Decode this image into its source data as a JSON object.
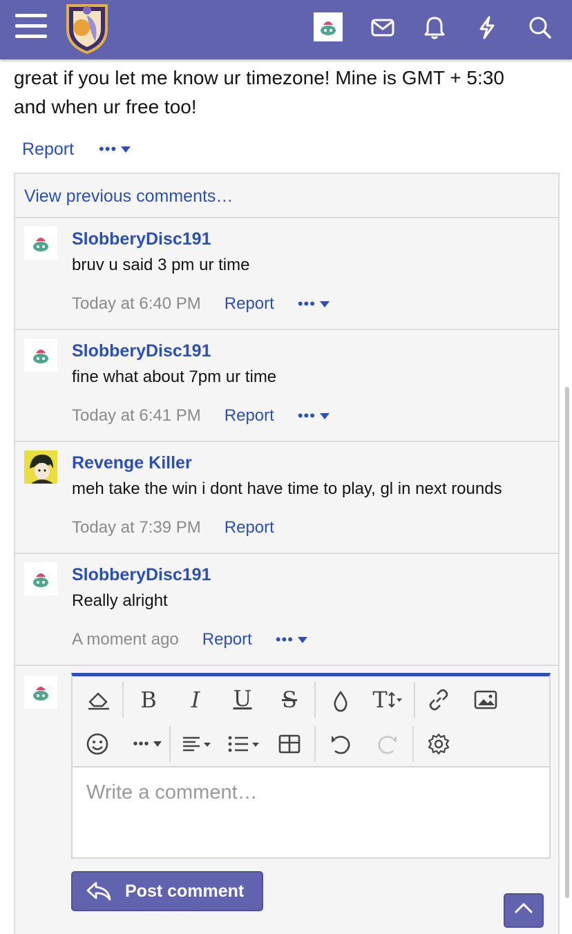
{
  "nav": {
    "icons": [
      "menu-icon",
      "site-logo",
      "user-avatar",
      "inbox-icon",
      "bell-icon",
      "bolt-icon",
      "search-icon"
    ],
    "accent": "#6163ae"
  },
  "post": {
    "text_line1": "great if you let me know ur timezone! Mine is GMT + 5:30",
    "text_line2": "and when ur free too!",
    "report_label": "Report",
    "more_label": "•••"
  },
  "comments": {
    "view_previous": "View previous comments…",
    "items": [
      {
        "user": "SlobberyDisc191",
        "text": "bruv u said 3 pm ur time",
        "time": "Today at 6:40 PM",
        "report": "Report",
        "more": "•••"
      },
      {
        "user": "SlobberyDisc191",
        "text": "fine what about 7pm ur time",
        "time": "Today at 6:41 PM",
        "report": "Report",
        "more": "•••"
      },
      {
        "user": "Revenge Killer",
        "text": "meh take the win i dont have time to play, gl in next rounds",
        "time": "Today at 7:39 PM",
        "report": "Report"
      },
      {
        "user": "SlobberyDisc191",
        "text": "Really alright",
        "time": "A moment ago",
        "report": "Report",
        "more": "•••"
      }
    ]
  },
  "reply": {
    "toolbar": {
      "bold": "B",
      "italic": "I",
      "underline": "U",
      "strike": "S",
      "text_size": "T",
      "more": "•••"
    },
    "placeholder": "Write a comment…",
    "post_button": "Post comment"
  },
  "link_color": "#2b4fb4"
}
